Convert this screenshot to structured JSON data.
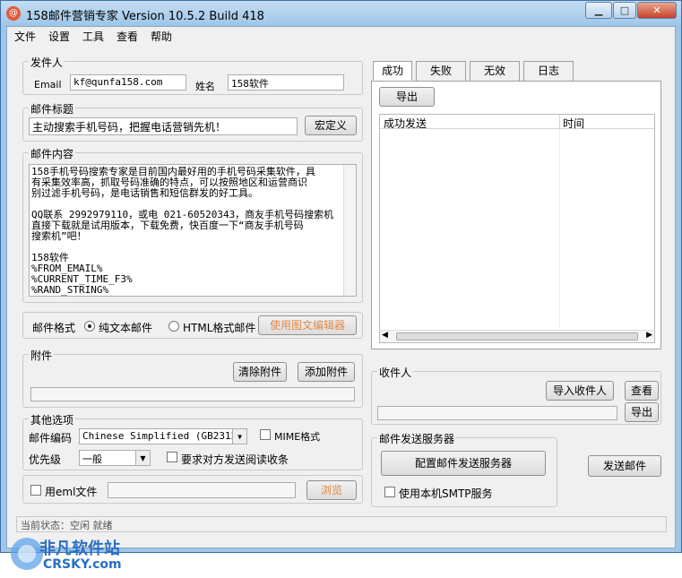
{
  "window": {
    "title": "158邮件营销专家 Version 10.5.2 Build 418",
    "icon": "mail-icon",
    "accent": "#9ec6e8"
  },
  "menu": [
    "文件",
    "设置",
    "工具",
    "查看",
    "帮助"
  ],
  "sender": {
    "group_label": "发件人",
    "email_label": "Email",
    "email_value": "kf@qunfa158.com",
    "name_label": "姓名",
    "name_value": "158软件"
  },
  "subject": {
    "group_label": "邮件标题",
    "value": "主动搜索手机号码，把握电话营销先机！",
    "custom_button": "宏定义"
  },
  "content": {
    "group_label": "邮件内容",
    "lines": [
      "158手机号码搜索专家是目前国内最好用的手机号码采集软件，具",
      "有采集效率高，抓取号码准确的特点，可以按照地区和运营商识",
      "别过滤手机号码，是电话销售和短信群发的好工具。",
      "",
      "QQ联系 2992979110，或电 021-60520343，商友手机号码搜索机",
      "直接下载就是试用版本，下载免费，快百度一下“商友手机号码",
      "搜索机”吧！",
      "",
      "158软件",
      "%FROM_EMAIL%",
      "%CURRENT_TIME_F3%",
      "%RAND_STRING%"
    ]
  },
  "format": {
    "label": "邮件格式",
    "option_text": "纯文本邮件",
    "option_html": "HTML格式邮件",
    "editor_button": "使用图文编辑器"
  },
  "attachment": {
    "group_label": "附件",
    "clear_button": "清除附件",
    "add_button": "添加附件"
  },
  "options": {
    "group_label": "其他选项",
    "encoding_label": "邮件编码",
    "encoding_value": "Chinese Simplified (GB2312)",
    "mime_label": "MIME格式",
    "priority_label": "优先级",
    "priority_value": "一般",
    "receipt_label": "要求对方发送阅读收条"
  },
  "eml": {
    "label": "用eml文件",
    "browse_button": "浏览"
  },
  "status": {
    "text": "当前状态：空闲 就绪"
  },
  "tabs": [
    "成功",
    "失败",
    "无效",
    "日志"
  ],
  "results": {
    "export_button": "导出",
    "columns": [
      "成功发送",
      "时间"
    ]
  },
  "recipients": {
    "group_label": "收件人",
    "import_button": "导入收件人",
    "view_button": "查看",
    "export_button": "导出"
  },
  "server": {
    "group_label": "邮件发送服务器",
    "config_button": "配置邮件发送服务器",
    "local_smtp_label": "使用本机SMTP服务"
  },
  "send_button": "发送邮件",
  "watermark": {
    "text1": "非凡软件站",
    "text2": "CRSKY.com"
  }
}
